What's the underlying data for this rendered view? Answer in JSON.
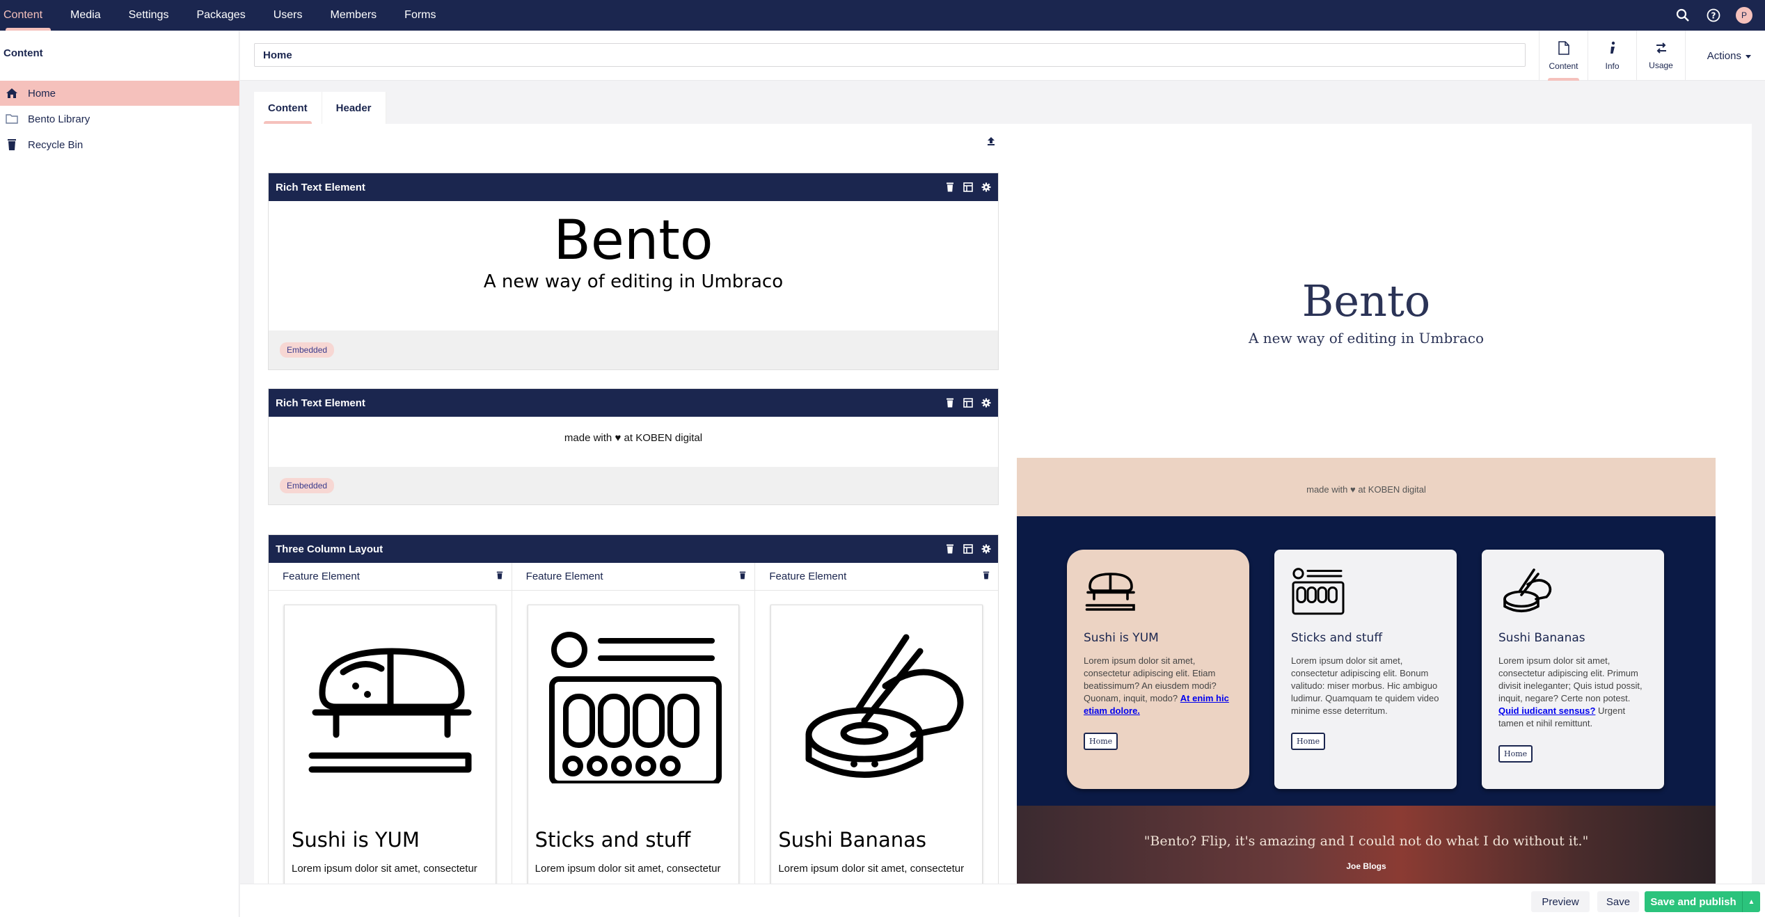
{
  "topnav": {
    "items": [
      "Content",
      "Media",
      "Settings",
      "Packages",
      "Users",
      "Members",
      "Forms"
    ],
    "active": "Content",
    "avatar_initial": "P"
  },
  "tree": {
    "title": "Content",
    "items": [
      {
        "label": "Home",
        "icon": "home-icon"
      },
      {
        "label": "Bento Library",
        "icon": "folder-icon"
      },
      {
        "label": "Recycle Bin",
        "icon": "trash-icon"
      }
    ]
  },
  "header": {
    "name_value": "Home",
    "apps": [
      {
        "label": "Content",
        "icon": "document-icon"
      },
      {
        "label": "Info",
        "icon": "info-icon"
      },
      {
        "label": "Usage",
        "icon": "swap-icon"
      }
    ],
    "actions_label": "Actions"
  },
  "content_tabs": [
    "Content",
    "Header"
  ],
  "blocks": {
    "rich1": {
      "title": "Rich Text Element",
      "heading": "Bento",
      "subheading": "A new way of editing in Umbraco",
      "badge": "Embedded"
    },
    "rich2": {
      "title": "Rich Text Element",
      "text_before": "made with",
      "text_after": "at KOBEN digital",
      "badge": "Embedded"
    },
    "three_col": {
      "title": "Three Column Layout",
      "columns": [
        {
          "head": "Feature Element",
          "card_title": "Sushi is YUM",
          "card_text": "Lorem ipsum dolor sit amet, consectetur"
        },
        {
          "head": "Feature Element",
          "card_title": "Sticks and stuff",
          "card_text": "Lorem ipsum dolor sit amet, consectetur"
        },
        {
          "head": "Feature Element",
          "card_title": "Sushi Bananas",
          "card_text": "Lorem ipsum dolor sit amet, consectetur"
        }
      ]
    }
  },
  "preview": {
    "title": "Bento",
    "subtitle": "A new way of editing in Umbraco",
    "made_before": "made with",
    "made_after": "at KOBEN digital",
    "cards": [
      {
        "title": "Sushi is YUM",
        "text": "Lorem ipsum dolor sit amet, consectetur adipiscing elit. Etiam beatissimum? An eiusdem modi? Quonam, inquit, modo?",
        "link": "At enim hic etiam dolore.",
        "text_after": "",
        "button": "Home"
      },
      {
        "title": "Sticks and stuff",
        "text": "Lorem ipsum dolor sit amet, consectetur adipiscing elit. Bonum valitudo: miser morbus. Hic ambiguo ludimur. Quamquam te quidem video minime esse deterritum.",
        "link": "",
        "text_after": "",
        "button": "Home"
      },
      {
        "title": "Sushi Bananas",
        "text": "Lorem ipsum dolor sit amet, consectetur adipiscing elit. Primum divisit ineleganter; Quis istud possit, inquit, negare? Certe non potest.",
        "link": "Quid iudicant sensus?",
        "text_after": "Urgent tamen et nihil remittunt.",
        "button": "Home"
      }
    ],
    "quote": "\"Bento? Flip, it's amazing and I could not do what I do without it.\"",
    "quote_author": "Joe Blogs"
  },
  "footer": {
    "preview_label": "Preview",
    "save_label": "Save",
    "publish_label": "Save and publish"
  },
  "colors": {
    "navy": "#1b264f",
    "accent_pink": "#f5c1bc",
    "publish_green": "#2bc37c",
    "preview_peach": "#ecd3c3",
    "preview_dark": "#0b1a45"
  }
}
